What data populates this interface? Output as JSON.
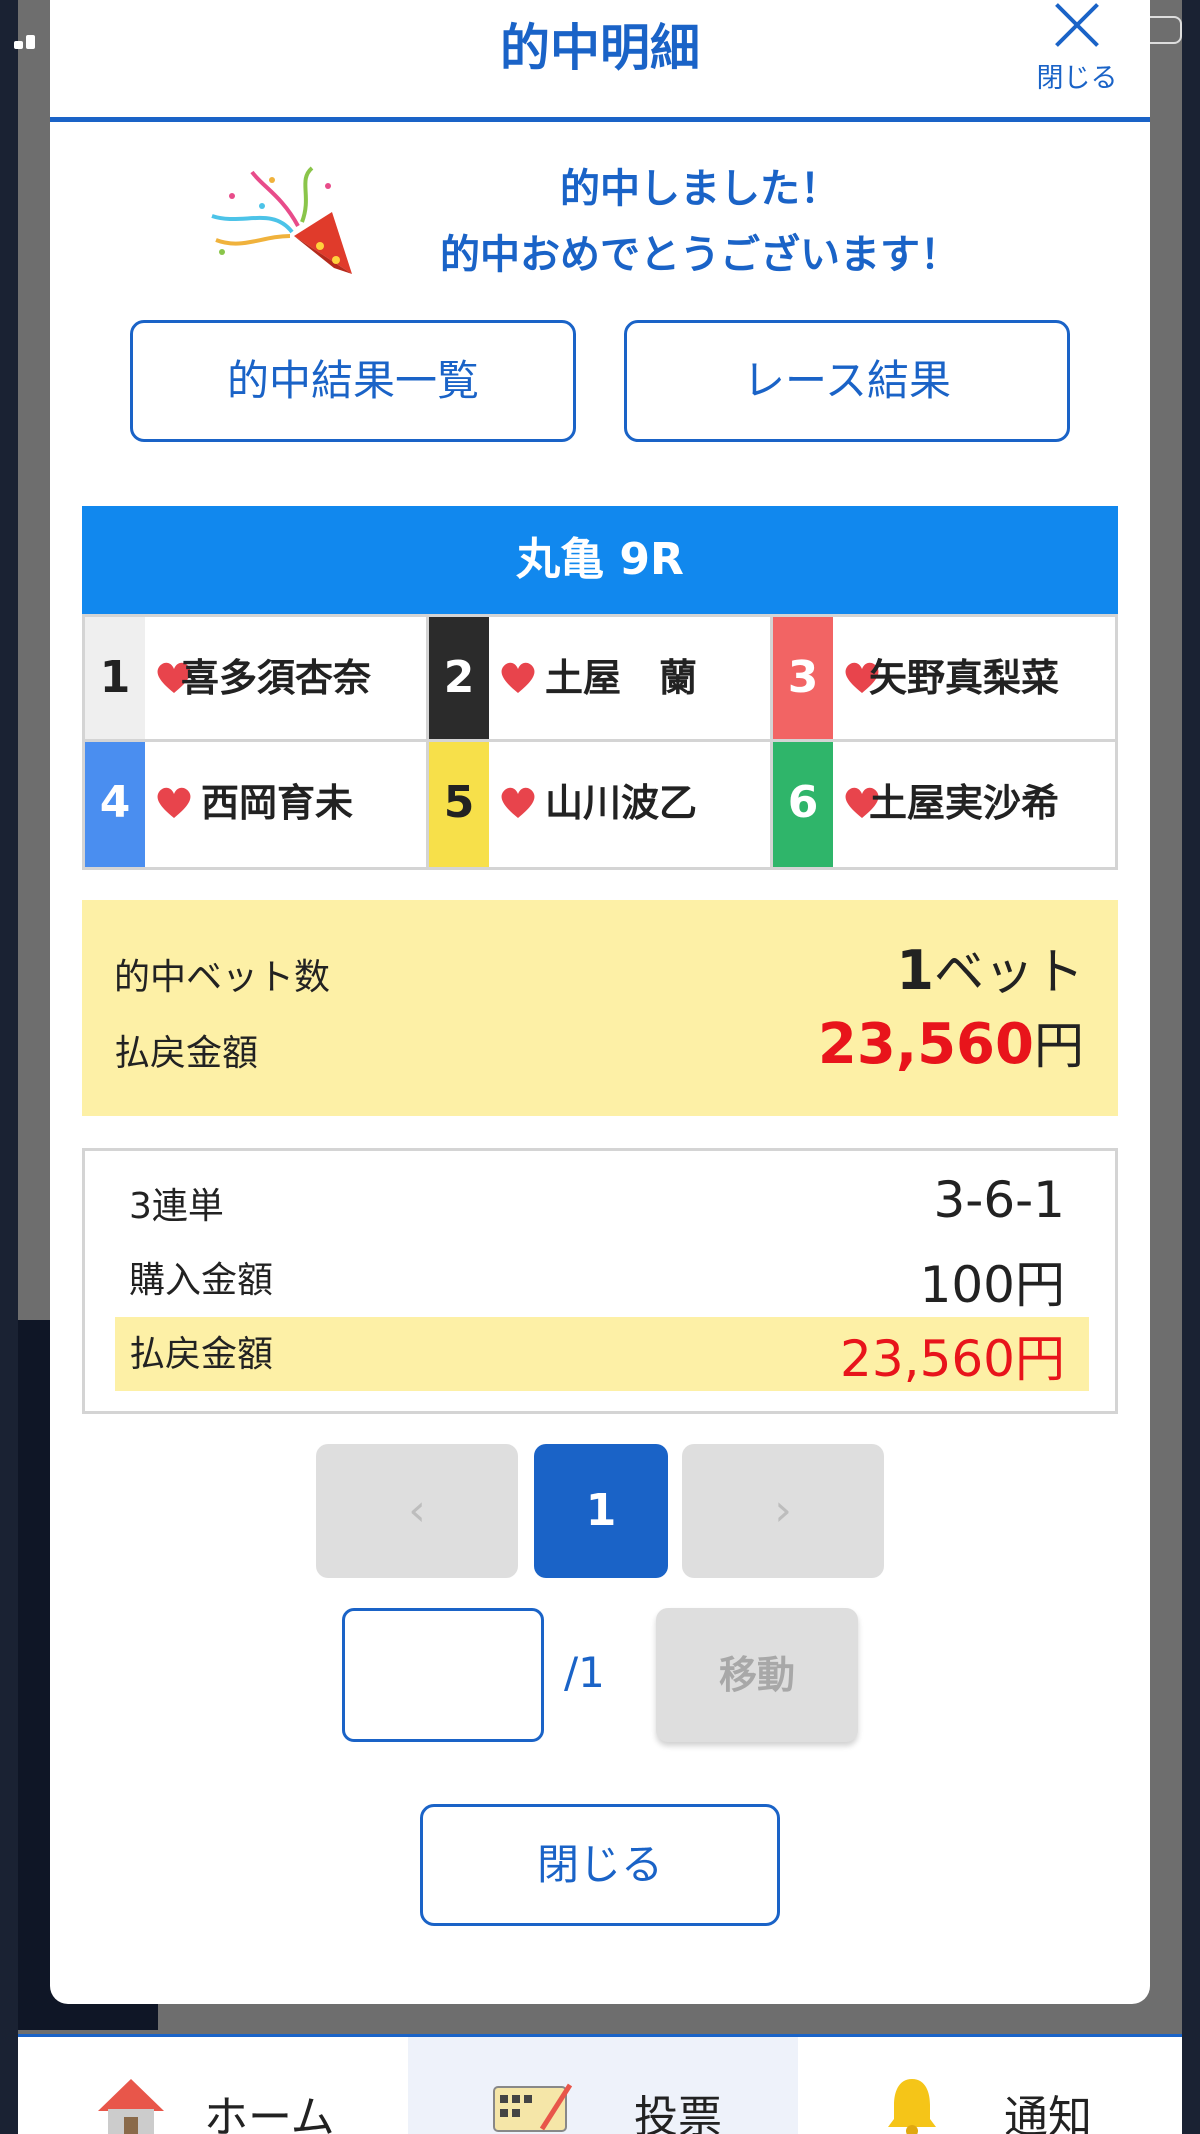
{
  "modal": {
    "title": "的中明細",
    "close_label": "閉じる",
    "congrats_line1": "的中しました！",
    "congrats_line2": "的中おめでとうございます！",
    "result_list_button": "的中結果一覧",
    "race_result_button": "レース結果"
  },
  "race": {
    "header": "丸亀 9R",
    "racers": [
      {
        "num": "1",
        "name": "喜多須杏奈",
        "color": "#efefef",
        "num_color": "#222222"
      },
      {
        "num": "2",
        "name": "土屋　蘭",
        "color": "#2b2b2b",
        "num_color": "#ffffff"
      },
      {
        "num": "3",
        "name": "矢野真梨菜",
        "color": "#f26464",
        "num_color": "#ffffff"
      },
      {
        "num": "4",
        "name": "西岡育未",
        "color": "#4a8ef0",
        "num_color": "#ffffff"
      },
      {
        "num": "5",
        "name": "山川波乙",
        "color": "#f7e04a",
        "num_color": "#222222"
      },
      {
        "num": "6",
        "name": "土屋実沙希",
        "color": "#2fb56a",
        "num_color": "#ffffff"
      }
    ],
    "heart_color": "#e8444c"
  },
  "summary": {
    "bet_count_label": "的中ベット数",
    "bet_count_value": "1",
    "bet_count_unit": "ベット",
    "payout_label": "払戻金額",
    "payout_value": "23,560",
    "payout_unit": "円"
  },
  "detail": {
    "bet_type_label": "3連単",
    "bet_type_value": "3-6-1",
    "purchase_label": "購入金額",
    "purchase_value": "100円",
    "payout_label": "払戻金額",
    "payout_value": "23,560円"
  },
  "pagination": {
    "prev": "‹",
    "current": "1",
    "next": "›",
    "input_value": "",
    "total": "/1",
    "move_label": "移動"
  },
  "footer_close": "閉じる",
  "bottom_nav": {
    "home": "ホーム",
    "vote": "投票",
    "notify": "通知"
  },
  "colors": {
    "accent": "#1a63c7",
    "race_header": "#1188ee",
    "highlight": "#fdf0a6",
    "payout_red": "#e8141b"
  }
}
